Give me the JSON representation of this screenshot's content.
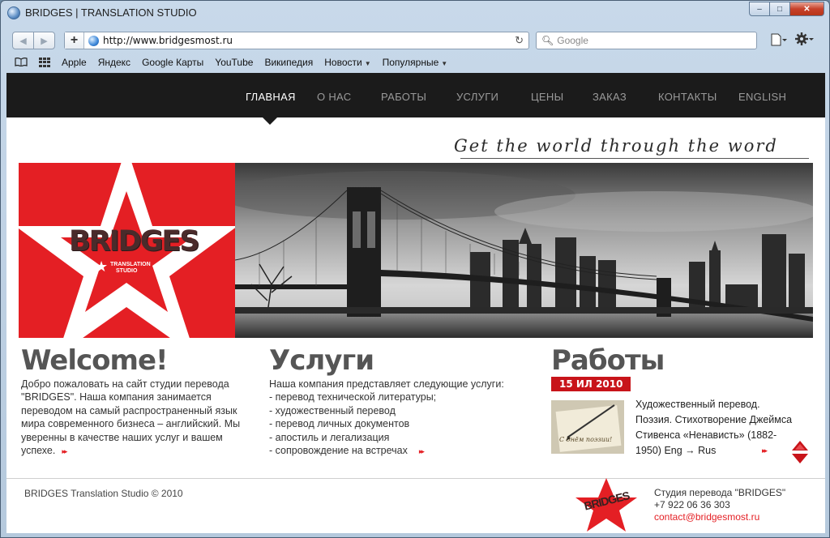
{
  "window": {
    "title": "BRIDGES | TRANSLATION STUDIO",
    "buttons": {
      "minimize": "–",
      "maximize": "□",
      "close": "✕"
    }
  },
  "toolbar": {
    "back": "◀",
    "forward": "▶",
    "plus": "+",
    "url": "http://www.bridgesmost.ru",
    "reload": "↻",
    "search_placeholder": "Google"
  },
  "bookmarks": {
    "items": [
      {
        "label": "Apple",
        "menu": false
      },
      {
        "label": "Яндекс",
        "menu": false
      },
      {
        "label": "Google Карты",
        "menu": false
      },
      {
        "label": "YouTube",
        "menu": false
      },
      {
        "label": "Википедия",
        "menu": false
      },
      {
        "label": "Новости",
        "menu": true
      },
      {
        "label": "Популярные",
        "menu": true
      }
    ]
  },
  "site": {
    "nav": [
      {
        "label": "ГЛАВНАЯ",
        "active": true
      },
      {
        "label": "О НАС",
        "active": false
      },
      {
        "label": "РАБОТЫ",
        "active": false
      },
      {
        "label": "УСЛУГИ",
        "active": false
      },
      {
        "label": "ЦЕНЫ",
        "active": false
      },
      {
        "label": "ЗАКАЗ",
        "active": false
      },
      {
        "label": "КОНТАКТЫ",
        "active": false
      },
      {
        "label": "ENGLISH",
        "active": false
      }
    ],
    "tagline": "Get the world through the word",
    "logo": {
      "name": "BRIDGES",
      "sub1": "TRANSLATION",
      "sub2": "STUDIO"
    },
    "welcome": {
      "title": "Welcome!",
      "text": "Добро пожаловать на сайт студии перевода \"BRIDGES\". Наша компания занимается переводом на самый распространенный язык мира современного бизнеса – английский. Мы уверенны в качестве наших услуг и вашем успехе.",
      "more": "▸▸"
    },
    "services": {
      "title": "Услуги",
      "intro": "Наша компания представляет следующие услуги:",
      "items": [
        "- перевод технической литературы;",
        "- художественный перевод",
        "- перевод личных документов",
        "- апостиль и легализация",
        "- сопровождение на встречах"
      ],
      "more": "▸▸"
    },
    "works": {
      "title": "Работы",
      "date": "15 ИЛ 2010",
      "thumb_caption": "С днём поэзии!",
      "text": "Художественный перевод. Поэзия. Стихотворение Джеймса Стивенса «Ненависть» (1882-1950) Eng → Rus",
      "more": "▸▸"
    },
    "footer": {
      "copyright": "BRIDGES Translation Studio © 2010",
      "studio": "Студия перевода \"BRIDGES\"",
      "phone": "+7 922 06 36 303",
      "email": "contact@bridgesmost.ru"
    }
  },
  "colors": {
    "accent_red": "#e41f24",
    "nav_bg": "#1b1b1b"
  }
}
